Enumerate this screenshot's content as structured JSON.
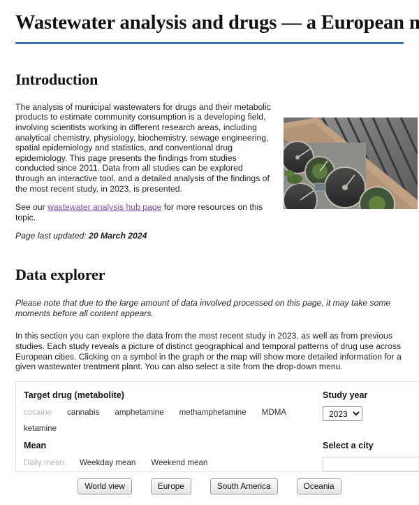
{
  "page": {
    "title": "Wastewater analysis and drugs — a European multi-city study"
  },
  "introduction": {
    "heading": "Introduction",
    "paragraph": "The analysis of municipal wastewaters for drugs and their metabolic products to estimate community consumption is a developing field, involving scientists working in different research areas, including analytical chemistry, physiology, biochemistry, sewage engineering, spatial epidemiology and statistics, and conventional drug epidemiology. This page presents the findings from studies conducted since 2011. Data from all studies can be explored through an interactive tool, and a detailed analysis of the findings of the most recent study, in 2023, is presented.",
    "link_sentence_before": "See our ",
    "link_text": "wastewater analysis hub page",
    "link_sentence_after": " for more resources on this topic.",
    "updated_label": "Page last updated:",
    "updated_date": "20 March 2024",
    "photo_alt": "aerial-view-of-wastewater-treatment-plant"
  },
  "data_explorer": {
    "heading": "Data explorer",
    "note": "Please note that due to the large amount of data involved processed on this page, it may take some moments before all content appears.",
    "paragraph": "In this section you can explore the data from the most recent study in 2023, as well as from previous studies. Each study reveals a picture of distinct geographical and temporal patterns of drug use across European cities. Clicking on a symbol in the graph or the map will show more detailed information for a given wastewater treatment plant. You can also select a site from the drop-down menu."
  },
  "controls": {
    "target_drug_label": "Target drug (metabolite)",
    "drugs": [
      {
        "label": "cocaine",
        "active": true
      },
      {
        "label": "cannabis",
        "active": false
      },
      {
        "label": "amphetamine",
        "active": false
      },
      {
        "label": "methamphetamine",
        "active": false
      },
      {
        "label": "MDMA",
        "active": false
      },
      {
        "label": "ketamine",
        "active": false
      }
    ],
    "mean_label": "Mean",
    "means": [
      {
        "label": "Daily mean",
        "active": true
      },
      {
        "label": "Weekday mean",
        "active": false
      },
      {
        "label": "Weekend mean",
        "active": false
      }
    ],
    "study_year_label": "Study year",
    "study_year_value": "2023",
    "study_year_options": [
      "2023"
    ],
    "city_label": "Select a city",
    "city_value": "",
    "city_placeholder": ""
  },
  "view_buttons": [
    "World view",
    "Europe",
    "South America",
    "Oceania"
  ],
  "colors": {
    "title_rule": "#3d6fb8",
    "link": "#7a4fa8",
    "active_tab": "#b3b3b3",
    "tab": "#2f2f2f"
  }
}
